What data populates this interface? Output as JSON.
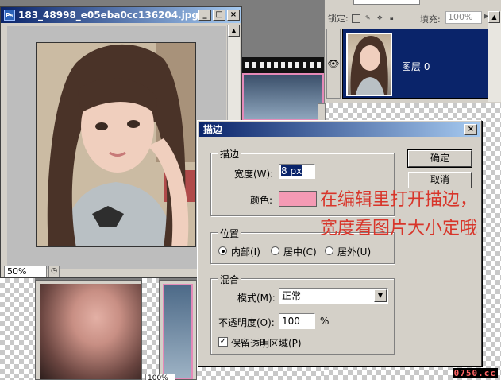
{
  "photo_window": {
    "title": "183_48998_e05eba0cc136204.jpg @ ...",
    "zoom": "50%"
  },
  "layers_panel": {
    "lock_label": "锁定:",
    "fill_label": "填充:",
    "fill_value": "100%",
    "layer_name": "图层 0"
  },
  "lower_doc": {
    "zoom": "100%"
  },
  "stroke_dialog": {
    "title": "描边",
    "stroke_group": "描边",
    "width_label": "宽度(W):",
    "width_value": "8 px",
    "color_label": "颜色:",
    "color_value": "#f49ab4",
    "location_group": "位置",
    "location_options": [
      "内部(I)",
      "居中(C)",
      "居外(U)"
    ],
    "location_selected": "内部(I)",
    "blend_group": "混合",
    "mode_label": "模式(M):",
    "mode_value": "正常",
    "opacity_label": "不透明度(O):",
    "opacity_value": "100",
    "opacity_unit": "%",
    "preserve_label": "保留透明区域(P)",
    "preserve_checked": true,
    "ok_label": "确定",
    "cancel_label": "取消",
    "annotation": "在编辑里打开描边，宽度看图片大小定哦"
  },
  "watermark": "0750.cc"
}
